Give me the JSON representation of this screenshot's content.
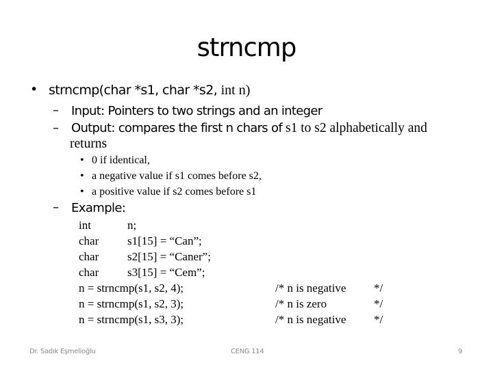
{
  "slide": {
    "title": "strncmp",
    "bullet": {
      "marker": "•",
      "signature_sans": "strncmp(char *s1, char *s2, ",
      "signature_serif": "int n)"
    },
    "sub_bullets": [
      {
        "marker": "–",
        "sans": "Input:  Pointers to two strings and an integer",
        "serif": ""
      },
      {
        "marker": "–",
        "sans": "Output:  compares the first n chars of ",
        "serif": "s1 to s2 alphabetically and"
      },
      {
        "marker": "",
        "sans": "",
        "serif": "returns"
      }
    ],
    "return_items": [
      {
        "marker": "•",
        "text": "0 if identical,"
      },
      {
        "marker": "•",
        "text": "a negative value if s1 comes before s2,"
      },
      {
        "marker": "•",
        "text": "a positive value if s2 comes before s1"
      }
    ],
    "example": {
      "marker": "–",
      "label": "Example:"
    },
    "code_decls": [
      {
        "type": "int",
        "rest": "n;"
      },
      {
        "type": "char",
        "rest": "s1[15] = “Can”;"
      },
      {
        "type": "char",
        "rest": "s2[15] = “Caner”;"
      },
      {
        "type": "char",
        "rest": "s3[15] = “Cem”;"
      }
    ],
    "code_calls": [
      {
        "stmt": "n = strncmp(s1, s2, 4);",
        "comment": "/* n is negative",
        "end": "*/"
      },
      {
        "stmt": "n = strncmp(s1, s2, 3);",
        "comment": "/* n is zero",
        "end": "*/"
      },
      {
        "stmt": "n = strncmp(s1, s3, 3);",
        "comment": "/* n is negative",
        "end": "*/"
      }
    ]
  },
  "footer": {
    "author": "Dr. Sadık Eşmelioğlu",
    "course": "CENG 114",
    "page": "9"
  }
}
